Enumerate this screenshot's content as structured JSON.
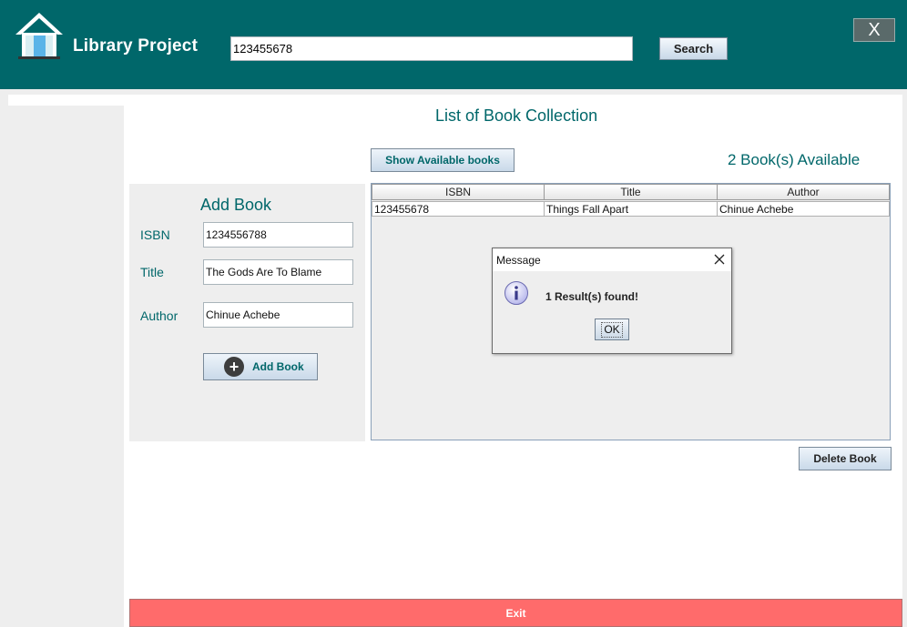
{
  "header": {
    "app_title": "Library Project",
    "search_value": "123455678",
    "search_label": "Search",
    "close_label": "X"
  },
  "main": {
    "list_heading": "List of Book Collection",
    "show_available_label": "Show Available books",
    "available_text": "2 Book(s) Available"
  },
  "add_book": {
    "heading": "Add Book",
    "isbn_label": "ISBN",
    "isbn_value": "1234556788",
    "title_label": "Title",
    "title_value": "The Gods Are To Blame",
    "author_label": "Author",
    "author_value": "Chinue Achebe",
    "button_label": "Add Book"
  },
  "table": {
    "columns": [
      "ISBN",
      "Title",
      "Author"
    ],
    "rows": [
      [
        "123455678",
        "Things Fall Apart",
        "Chinue Achebe"
      ]
    ]
  },
  "dialog": {
    "title": "Message",
    "message": "1 Result(s) found!",
    "ok_label": "OK"
  },
  "actions": {
    "delete_label": "Delete Book",
    "exit_label": "Exit"
  },
  "colors": {
    "header_bg": "#00676a",
    "accent_text": "#00676a",
    "exit_bg": "#ff6b6b",
    "panel_bg": "#eeeeee"
  },
  "icons": {
    "logo": "house-icon",
    "add": "plus-circle-icon",
    "info": "info-icon",
    "dialog_close": "close-icon"
  }
}
